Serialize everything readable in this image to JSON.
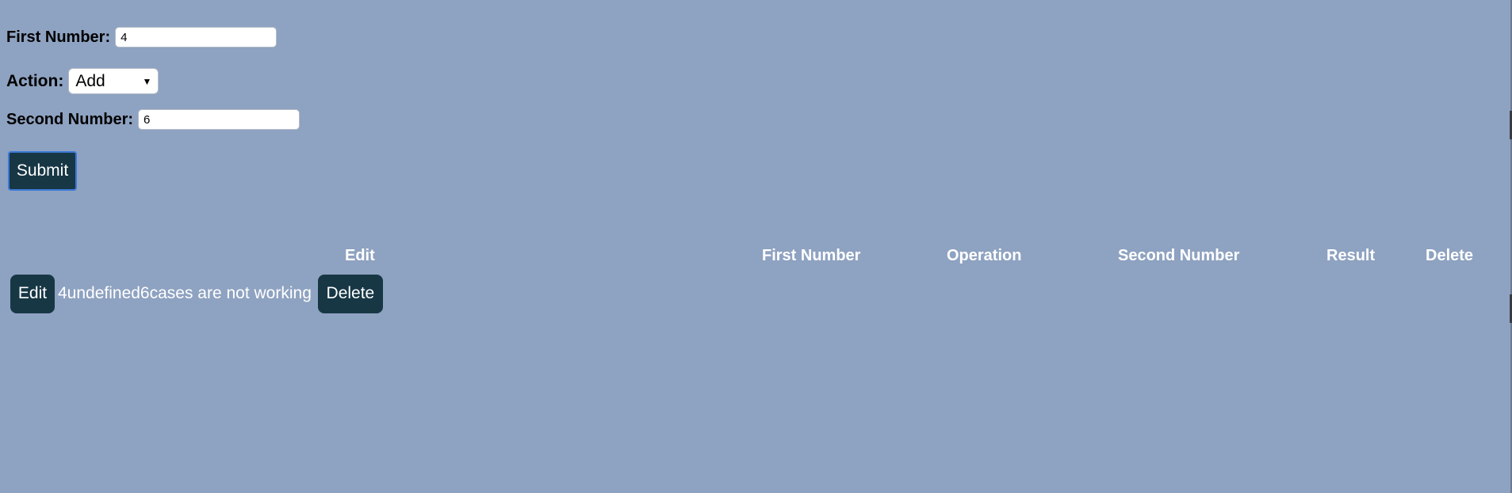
{
  "form": {
    "first_number": {
      "label": "First Number:",
      "value": "4"
    },
    "action": {
      "label": "Action:",
      "selected": "Add"
    },
    "second_number": {
      "label": "Second Number:",
      "value": "6"
    },
    "submit_label": "Submit"
  },
  "table": {
    "headers": [
      "Edit",
      "First Number",
      "Operation",
      "Second Number",
      "Result",
      "Delete"
    ],
    "rows": [
      {
        "edit_label": "Edit",
        "text": "4undefined6cases are not working",
        "delete_label": "Delete"
      }
    ]
  },
  "colors": {
    "background": "#8ea2c1",
    "button": "#173745",
    "button_text": "#ffffff",
    "focus_border": "#3d78d8"
  },
  "icons": {
    "select_arrow": "dropdown-arrow-icon"
  }
}
